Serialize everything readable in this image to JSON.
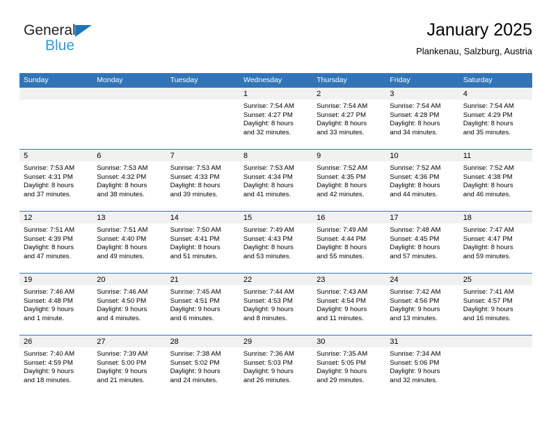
{
  "brand": {
    "name_part1": "General",
    "name_part2": "Blue",
    "triangle_icon": "blue-triangle-logo-mark",
    "colors": {
      "text_dark": "#231f20",
      "blue_light": "#2e9bdc",
      "triangle": "#1b75bb"
    }
  },
  "header": {
    "title": "January 2025",
    "subtitle": "Plankenau, Salzburg, Austria"
  },
  "theme": {
    "header_blue": "#3175b8",
    "daynum_band": "#f1f1f1",
    "separator_blue": "#3175b8"
  },
  "weekday_headers": [
    "Sunday",
    "Monday",
    "Tuesday",
    "Wednesday",
    "Thursday",
    "Friday",
    "Saturday"
  ],
  "weeks": [
    {
      "days": [
        {
          "num": "",
          "empty": true,
          "sunrise": "",
          "sunset": "",
          "daylight_line1": "",
          "daylight_line2": ""
        },
        {
          "num": "",
          "empty": true,
          "sunrise": "",
          "sunset": "",
          "daylight_line1": "",
          "daylight_line2": ""
        },
        {
          "num": "",
          "empty": true,
          "sunrise": "",
          "sunset": "",
          "daylight_line1": "",
          "daylight_line2": ""
        },
        {
          "num": "1",
          "empty": false,
          "sunrise": "Sunrise: 7:54 AM",
          "sunset": "Sunset: 4:27 PM",
          "daylight_line1": "Daylight: 8 hours",
          "daylight_line2": "and 32 minutes."
        },
        {
          "num": "2",
          "empty": false,
          "sunrise": "Sunrise: 7:54 AM",
          "sunset": "Sunset: 4:27 PM",
          "daylight_line1": "Daylight: 8 hours",
          "daylight_line2": "and 33 minutes."
        },
        {
          "num": "3",
          "empty": false,
          "sunrise": "Sunrise: 7:54 AM",
          "sunset": "Sunset: 4:28 PM",
          "daylight_line1": "Daylight: 8 hours",
          "daylight_line2": "and 34 minutes."
        },
        {
          "num": "4",
          "empty": false,
          "sunrise": "Sunrise: 7:54 AM",
          "sunset": "Sunset: 4:29 PM",
          "daylight_line1": "Daylight: 8 hours",
          "daylight_line2": "and 35 minutes."
        }
      ]
    },
    {
      "days": [
        {
          "num": "5",
          "empty": false,
          "sunrise": "Sunrise: 7:53 AM",
          "sunset": "Sunset: 4:31 PM",
          "daylight_line1": "Daylight: 8 hours",
          "daylight_line2": "and 37 minutes."
        },
        {
          "num": "6",
          "empty": false,
          "sunrise": "Sunrise: 7:53 AM",
          "sunset": "Sunset: 4:32 PM",
          "daylight_line1": "Daylight: 8 hours",
          "daylight_line2": "and 38 minutes."
        },
        {
          "num": "7",
          "empty": false,
          "sunrise": "Sunrise: 7:53 AM",
          "sunset": "Sunset: 4:33 PM",
          "daylight_line1": "Daylight: 8 hours",
          "daylight_line2": "and 39 minutes."
        },
        {
          "num": "8",
          "empty": false,
          "sunrise": "Sunrise: 7:53 AM",
          "sunset": "Sunset: 4:34 PM",
          "daylight_line1": "Daylight: 8 hours",
          "daylight_line2": "and 41 minutes."
        },
        {
          "num": "9",
          "empty": false,
          "sunrise": "Sunrise: 7:52 AM",
          "sunset": "Sunset: 4:35 PM",
          "daylight_line1": "Daylight: 8 hours",
          "daylight_line2": "and 42 minutes."
        },
        {
          "num": "10",
          "empty": false,
          "sunrise": "Sunrise: 7:52 AM",
          "sunset": "Sunset: 4:36 PM",
          "daylight_line1": "Daylight: 8 hours",
          "daylight_line2": "and 44 minutes."
        },
        {
          "num": "11",
          "empty": false,
          "sunrise": "Sunrise: 7:52 AM",
          "sunset": "Sunset: 4:38 PM",
          "daylight_line1": "Daylight: 8 hours",
          "daylight_line2": "and 46 minutes."
        }
      ]
    },
    {
      "days": [
        {
          "num": "12",
          "empty": false,
          "sunrise": "Sunrise: 7:51 AM",
          "sunset": "Sunset: 4:39 PM",
          "daylight_line1": "Daylight: 8 hours",
          "daylight_line2": "and 47 minutes."
        },
        {
          "num": "13",
          "empty": false,
          "sunrise": "Sunrise: 7:51 AM",
          "sunset": "Sunset: 4:40 PM",
          "daylight_line1": "Daylight: 8 hours",
          "daylight_line2": "and 49 minutes."
        },
        {
          "num": "14",
          "empty": false,
          "sunrise": "Sunrise: 7:50 AM",
          "sunset": "Sunset: 4:41 PM",
          "daylight_line1": "Daylight: 8 hours",
          "daylight_line2": "and 51 minutes."
        },
        {
          "num": "15",
          "empty": false,
          "sunrise": "Sunrise: 7:49 AM",
          "sunset": "Sunset: 4:43 PM",
          "daylight_line1": "Daylight: 8 hours",
          "daylight_line2": "and 53 minutes."
        },
        {
          "num": "16",
          "empty": false,
          "sunrise": "Sunrise: 7:49 AM",
          "sunset": "Sunset: 4:44 PM",
          "daylight_line1": "Daylight: 8 hours",
          "daylight_line2": "and 55 minutes."
        },
        {
          "num": "17",
          "empty": false,
          "sunrise": "Sunrise: 7:48 AM",
          "sunset": "Sunset: 4:45 PM",
          "daylight_line1": "Daylight: 8 hours",
          "daylight_line2": "and 57 minutes."
        },
        {
          "num": "18",
          "empty": false,
          "sunrise": "Sunrise: 7:47 AM",
          "sunset": "Sunset: 4:47 PM",
          "daylight_line1": "Daylight: 8 hours",
          "daylight_line2": "and 59 minutes."
        }
      ]
    },
    {
      "days": [
        {
          "num": "19",
          "empty": false,
          "sunrise": "Sunrise: 7:46 AM",
          "sunset": "Sunset: 4:48 PM",
          "daylight_line1": "Daylight: 9 hours",
          "daylight_line2": "and 1 minute."
        },
        {
          "num": "20",
          "empty": false,
          "sunrise": "Sunrise: 7:46 AM",
          "sunset": "Sunset: 4:50 PM",
          "daylight_line1": "Daylight: 9 hours",
          "daylight_line2": "and 4 minutes."
        },
        {
          "num": "21",
          "empty": false,
          "sunrise": "Sunrise: 7:45 AM",
          "sunset": "Sunset: 4:51 PM",
          "daylight_line1": "Daylight: 9 hours",
          "daylight_line2": "and 6 minutes."
        },
        {
          "num": "22",
          "empty": false,
          "sunrise": "Sunrise: 7:44 AM",
          "sunset": "Sunset: 4:53 PM",
          "daylight_line1": "Daylight: 9 hours",
          "daylight_line2": "and 8 minutes."
        },
        {
          "num": "23",
          "empty": false,
          "sunrise": "Sunrise: 7:43 AM",
          "sunset": "Sunset: 4:54 PM",
          "daylight_line1": "Daylight: 9 hours",
          "daylight_line2": "and 11 minutes."
        },
        {
          "num": "24",
          "empty": false,
          "sunrise": "Sunrise: 7:42 AM",
          "sunset": "Sunset: 4:56 PM",
          "daylight_line1": "Daylight: 9 hours",
          "daylight_line2": "and 13 minutes."
        },
        {
          "num": "25",
          "empty": false,
          "sunrise": "Sunrise: 7:41 AM",
          "sunset": "Sunset: 4:57 PM",
          "daylight_line1": "Daylight: 9 hours",
          "daylight_line2": "and 16 minutes."
        }
      ]
    },
    {
      "days": [
        {
          "num": "26",
          "empty": false,
          "sunrise": "Sunrise: 7:40 AM",
          "sunset": "Sunset: 4:59 PM",
          "daylight_line1": "Daylight: 9 hours",
          "daylight_line2": "and 18 minutes."
        },
        {
          "num": "27",
          "empty": false,
          "sunrise": "Sunrise: 7:39 AM",
          "sunset": "Sunset: 5:00 PM",
          "daylight_line1": "Daylight: 9 hours",
          "daylight_line2": "and 21 minutes."
        },
        {
          "num": "28",
          "empty": false,
          "sunrise": "Sunrise: 7:38 AM",
          "sunset": "Sunset: 5:02 PM",
          "daylight_line1": "Daylight: 9 hours",
          "daylight_line2": "and 24 minutes."
        },
        {
          "num": "29",
          "empty": false,
          "sunrise": "Sunrise: 7:36 AM",
          "sunset": "Sunset: 5:03 PM",
          "daylight_line1": "Daylight: 9 hours",
          "daylight_line2": "and 26 minutes."
        },
        {
          "num": "30",
          "empty": false,
          "sunrise": "Sunrise: 7:35 AM",
          "sunset": "Sunset: 5:05 PM",
          "daylight_line1": "Daylight: 9 hours",
          "daylight_line2": "and 29 minutes."
        },
        {
          "num": "31",
          "empty": false,
          "sunrise": "Sunrise: 7:34 AM",
          "sunset": "Sunset: 5:06 PM",
          "daylight_line1": "Daylight: 9 hours",
          "daylight_line2": "and 32 minutes."
        },
        {
          "num": "",
          "empty": true,
          "sunrise": "",
          "sunset": "",
          "daylight_line1": "",
          "daylight_line2": ""
        }
      ]
    }
  ]
}
